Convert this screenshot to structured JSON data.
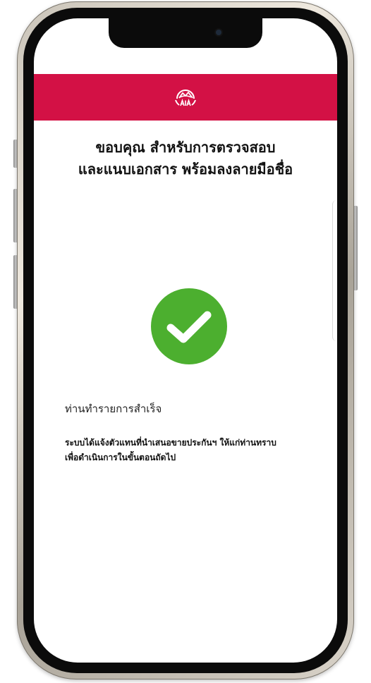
{
  "header": {
    "brand": "AIA",
    "brand_color": "#d31145"
  },
  "title": {
    "line1": "ขอบคุณ สำหรับการตรวจสอบ",
    "line2": "และแนบเอกสาร พร้อมลงลายมือชื่อ"
  },
  "success": {
    "icon": "check-circle-icon",
    "color": "#4caf2f"
  },
  "status_text": "ท่านทำรายการสำเร็จ",
  "detail": {
    "line1": "ระบบได้แจ้งตัวแทนที่นำเสนอขายประกันฯ ให้แก่ท่านทราบ",
    "line2": "เพื่อดำเนินการในขั้นตอนถัดไป"
  }
}
